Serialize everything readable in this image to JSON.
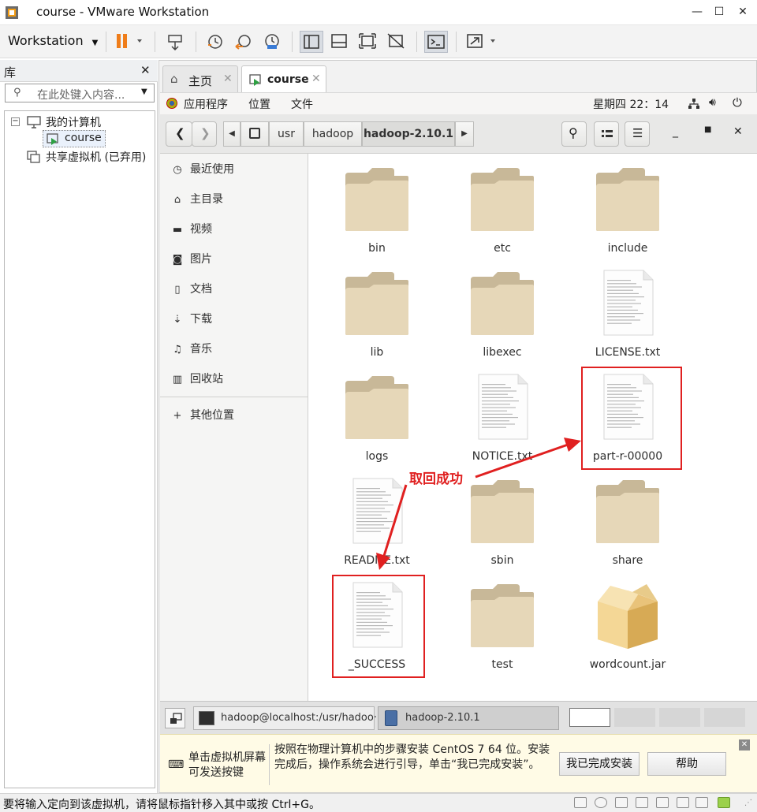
{
  "window": {
    "title": "course - VMware Workstation"
  },
  "toolbar": {
    "menu_label": "Workstation"
  },
  "library": {
    "title": "库",
    "search_placeholder": "在此处键入内容...",
    "tree": [
      {
        "label": "我的计算机"
      },
      {
        "label": "course"
      },
      {
        "label": "共享虚拟机 (已弃用)"
      }
    ]
  },
  "tabs": [
    {
      "label": "主页"
    },
    {
      "label": "course"
    }
  ],
  "gnome": {
    "menus": [
      "应用程序",
      "位置",
      "文件"
    ],
    "clock": "星期四 22：14"
  },
  "nautilus": {
    "crumbs": [
      "usr",
      "hadoop",
      "hadoop-2.10.1"
    ],
    "sidebar": [
      {
        "icon": "clock-icon",
        "label": "最近使用"
      },
      {
        "icon": "home-icon",
        "label": "主目录"
      },
      {
        "icon": "video-icon",
        "label": "视频"
      },
      {
        "icon": "camera-icon",
        "label": "图片"
      },
      {
        "icon": "document-icon",
        "label": "文档"
      },
      {
        "icon": "download-icon",
        "label": "下载"
      },
      {
        "icon": "music-icon",
        "label": "音乐"
      },
      {
        "icon": "trash-icon",
        "label": "回收站"
      },
      {
        "icon": "plus-icon",
        "label": "其他位置"
      }
    ],
    "files": [
      {
        "name": "bin",
        "type": "folder"
      },
      {
        "name": "etc",
        "type": "folder"
      },
      {
        "name": "include",
        "type": "folder"
      },
      {
        "name": "lib",
        "type": "folder"
      },
      {
        "name": "libexec",
        "type": "folder"
      },
      {
        "name": "LICENSE.txt",
        "type": "text"
      },
      {
        "name": "logs",
        "type": "folder"
      },
      {
        "name": "NOTICE.txt",
        "type": "text"
      },
      {
        "name": "part-r-00000",
        "type": "text"
      },
      {
        "name": "README.txt",
        "type": "text"
      },
      {
        "name": "sbin",
        "type": "folder"
      },
      {
        "name": "share",
        "type": "folder"
      },
      {
        "name": "_SUCCESS",
        "type": "text"
      },
      {
        "name": "test",
        "type": "folder"
      },
      {
        "name": "wordcount.jar",
        "type": "archive"
      }
    ],
    "annotation": "取回成功"
  },
  "vm_taskbar": {
    "items": [
      "hadoop@localhost:/usr/hadoo···",
      "hadoop-2.10.1"
    ]
  },
  "hint": {
    "left_text": "单击虚拟机屏幕\n可发送按键",
    "message": "按照在物理计算机中的步骤安装 CentOS 7 64 位。安装完成后，操作系统会进行引导，单击“我已完成安装”。",
    "done_button": "我已完成安装",
    "help_button": "帮助"
  },
  "status": {
    "text": "要将输入定向到该虚拟机，请将鼠标指针移入其中或按 Ctrl+G。"
  },
  "colors": {
    "accent": "#e02020",
    "folder": "#e6d7b8",
    "folder_tab": "#c8b898"
  }
}
